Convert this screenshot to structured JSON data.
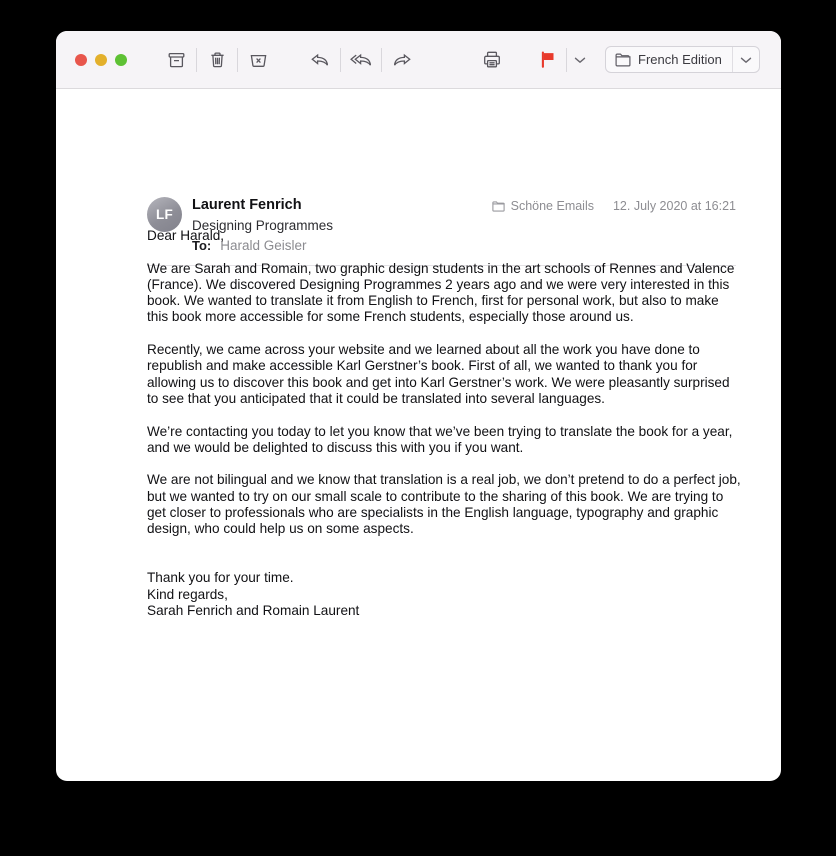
{
  "window": {
    "traffic_lights": [
      {
        "name": "close",
        "color": "#e8564c"
      },
      {
        "name": "minimize",
        "color": "#e3b02c"
      },
      {
        "name": "maximize",
        "color": "#5ec134"
      }
    ]
  },
  "toolbar": {
    "archive_label": "Archive",
    "delete_label": "Delete",
    "junk_label": "Move to Junk",
    "reply_label": "Reply",
    "reply_all_label": "Reply All",
    "forward_label": "Forward",
    "print_label": "Print",
    "flag_label": "Flag",
    "flag_color": "#e8392b",
    "flag_menu_label": "Flag options",
    "folder": {
      "icon": "folder-icon",
      "label": "French Edition",
      "chevron": "chevron-down-icon"
    }
  },
  "message": {
    "avatar_initials": "LF",
    "sender_name": "Laurent Fenrich",
    "sender_org": "Designing Programmes",
    "to_label": "To:",
    "to_value": "Harald Geisler",
    "mailbox_icon": "mailbox-folder-icon",
    "mailbox": "Schöne Emails",
    "date": "12. July 2020 at 16:21",
    "body": {
      "greeting": "Dear Harald,",
      "p1": "We are Sarah and Romain, two graphic design students in the art schools of Rennes and Valence (France). We discovered Designing Programmes 2 years ago and we were very interested in this book. We wanted to translate it from English to French, first for personal work, but also to make this book more accessible for some French students, especially those around us.",
      "p2": "Recently, we came across your website and we learned about all the work you have done to republish and make accessible Karl Gerstner’s book. First of all, we wanted to thank you for allowing us to discover this book and get into Karl Gerstner’s work. We were pleasantly surprised to see that you anticipated that it could be translated into several languages.",
      "p3": "We’re contacting you today to let you know that we’ve been trying to translate the book for a year, and we would be delighted to discuss this with you if you want.",
      "p4": "We are not bilingual and we know that translation is a real job, we don’t pretend to do a perfect job, but we wanted to try on our small scale to contribute to the sharing of this book. We are trying to get closer to professionals who are specialists in the English language, typography and graphic design, who could help us on some aspects.",
      "sign1": "Thank you for your time.",
      "sign2": "Kind regards,",
      "sign3": "Sarah Fenrich and Romain Laurent"
    }
  }
}
